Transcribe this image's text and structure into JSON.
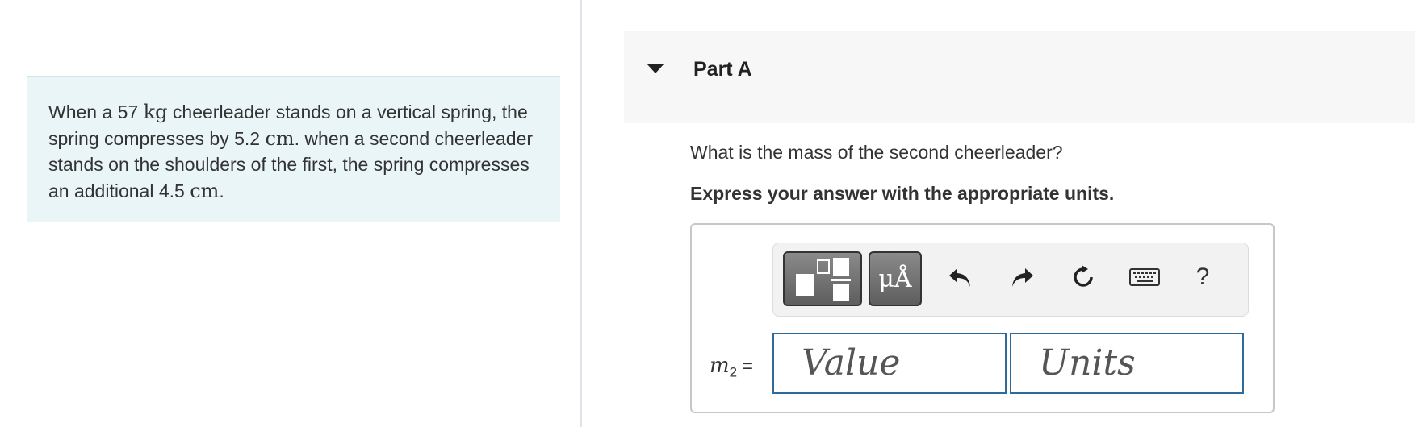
{
  "problem": {
    "segments": [
      {
        "text": "When a 57 ",
        "math": false
      },
      {
        "text": "kg",
        "math": true
      },
      {
        "text": " cheerleader stands on a vertical spring, the spring compresses by 5.2 ",
        "math": false
      },
      {
        "text": "cm",
        "math": true
      },
      {
        "text": ". when a second cheerleader stands on the shoulders of the first, the spring compresses an additional 4.5 ",
        "math": false
      },
      {
        "text": "cm",
        "math": true
      },
      {
        "text": ".",
        "math": false
      }
    ]
  },
  "part": {
    "title": "Part A",
    "question": "What is the mass of the second cheerleader?",
    "instruction": "Express your answer with the appropriate units."
  },
  "toolbar": {
    "templates_icon": "fraction-templates-icon",
    "units_label": "μÅ",
    "undo_icon": "undo-icon",
    "redo_icon": "redo-icon",
    "reset_icon": "reset-icon",
    "keyboard_icon": "keyboard-icon",
    "help_label": "?"
  },
  "answer": {
    "variable": "m",
    "subscript": "2",
    "equals": "=",
    "value_placeholder": "Value",
    "units_placeholder": "Units"
  },
  "colors": {
    "problem_bg": "#e9f5f7",
    "header_bg": "#f7f7f7",
    "field_border": "#2f6b9a",
    "toolbar_button": "#6f6f6f"
  }
}
